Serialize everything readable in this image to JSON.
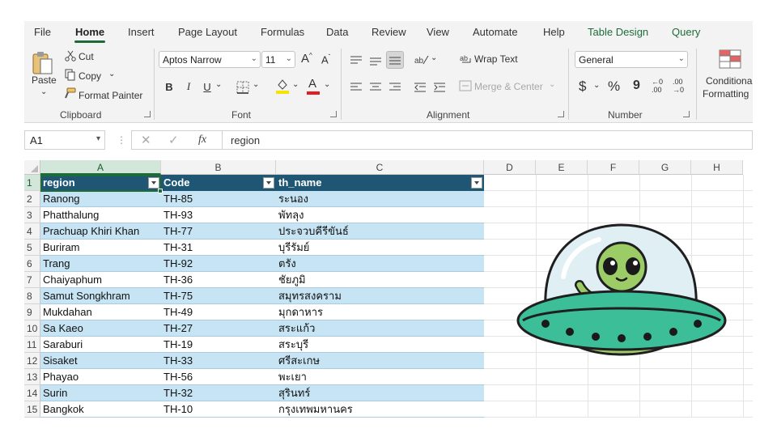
{
  "menu": {
    "tabs": [
      "File",
      "Home",
      "Insert",
      "Page Layout",
      "Formulas",
      "Data",
      "Review",
      "View",
      "Automate",
      "Help",
      "Table Design",
      "Query"
    ]
  },
  "clipboard": {
    "paste": "Paste",
    "cut": "Cut",
    "copy": "Copy",
    "format_painter": "Format Painter",
    "label": "Clipboard"
  },
  "font": {
    "name": "Aptos Narrow",
    "size": "11",
    "label": "Font",
    "bold": "B",
    "italic": "I",
    "underline": "U",
    "font_color_glyph": "A",
    "grow_glyph": "A",
    "shrink_glyph": "A"
  },
  "alignment": {
    "wrap_text": "Wrap Text",
    "merge_center": "Merge & Center",
    "label": "Alignment"
  },
  "number": {
    "format": "General",
    "label": "Number",
    "currency": "$",
    "percent": "%",
    "comma": "9",
    "inc_decimal_a": "←0",
    "inc_decimal_b": ".00",
    "dec_decimal_a": ".00",
    "dec_decimal_b": "→0"
  },
  "styles": {
    "conditional_line1": "Conditional",
    "conditional_line2": "Formatting"
  },
  "formula_bar": {
    "name_box": "A1",
    "content": "region",
    "fx": "fx"
  },
  "columns": [
    "A",
    "B",
    "C",
    "D",
    "E",
    "F",
    "G",
    "H"
  ],
  "table": {
    "headers": [
      "region",
      "Code",
      "th_name"
    ],
    "rows": [
      [
        "Ranong",
        "TH-85",
        "ระนอง"
      ],
      [
        "Phatthalung",
        "TH-93",
        "พัทลุง"
      ],
      [
        "Prachuap Khiri Khan",
        "TH-77",
        "ประจวบคีรีขันธ์"
      ],
      [
        "Buriram",
        "TH-31",
        "บุรีรัมย์"
      ],
      [
        "Trang",
        "TH-92",
        "ตรัง"
      ],
      [
        "Chaiyaphum",
        "TH-36",
        "ชัยภูมิ"
      ],
      [
        "Samut Songkhram",
        "TH-75",
        "สมุทรสงคราม"
      ],
      [
        "Mukdahan",
        "TH-49",
        "มุกดาหาร"
      ],
      [
        "Sa Kaeo",
        "TH-27",
        "สระแก้ว"
      ],
      [
        "Saraburi",
        "TH-19",
        "สระบุรี"
      ],
      [
        "Sisaket",
        "TH-33",
        "ศรีสะเกษ"
      ],
      [
        "Phayao",
        "TH-56",
        "พะเยา"
      ],
      [
        "Surin",
        "TH-32",
        "สุรินทร์"
      ],
      [
        "Bangkok",
        "TH-10",
        "กรุงเทพมหานคร"
      ]
    ]
  },
  "colors": {
    "accent": "#1e6b3a",
    "table_header": "#1f5673",
    "band": "#c6e4f3",
    "ufo_body": "#3cbf98",
    "alien": "#9ccc65"
  }
}
